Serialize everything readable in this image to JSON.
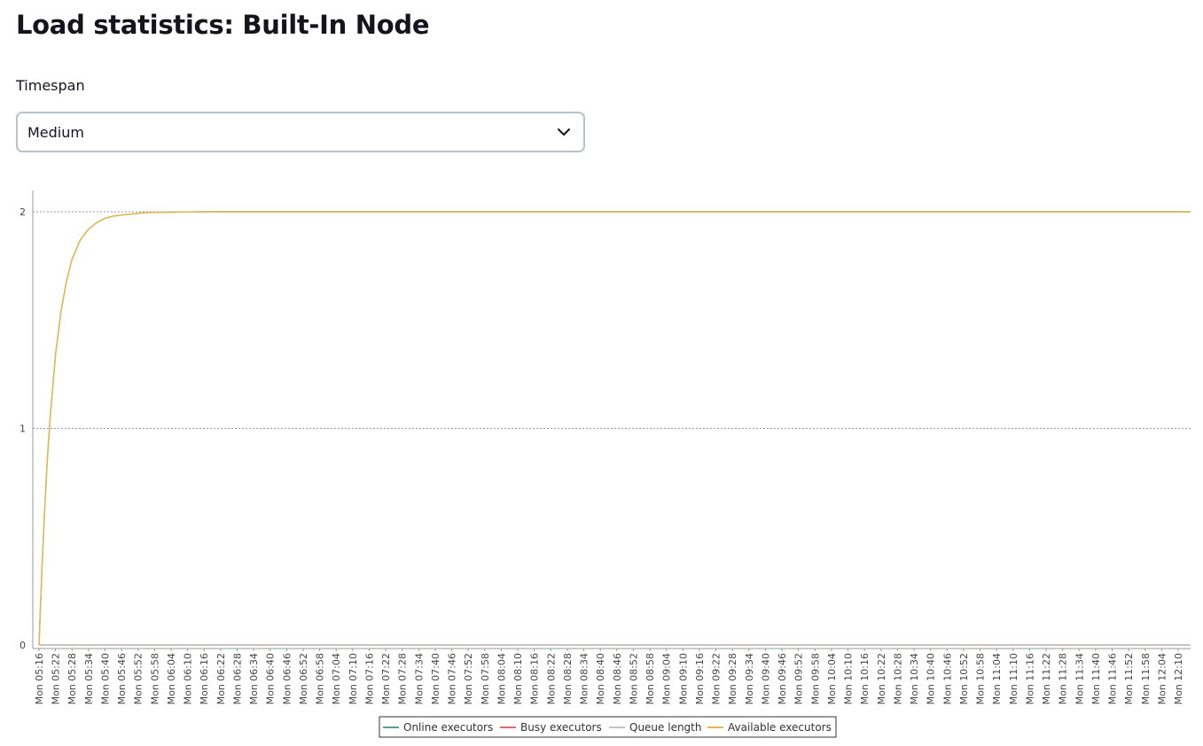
{
  "page": {
    "title": "Load statistics: Built-In Node"
  },
  "timespan": {
    "label": "Timespan",
    "selected": "Medium"
  },
  "icons": {
    "dropdown": "chevron-down-icon"
  },
  "chart_data": {
    "type": "line",
    "grid": true,
    "legend_position": "bottom-center",
    "ylim": [
      0,
      2
    ],
    "y_ticks": [
      "0",
      "1",
      "2"
    ],
    "x_tick_labels": [
      "Mon 05:16",
      "Mon 05:22",
      "Mon 05:28",
      "Mon 05:34",
      "Mon 05:40",
      "Mon 05:46",
      "Mon 05:52",
      "Mon 05:58",
      "Mon 06:04",
      "Mon 06:10",
      "Mon 06:16",
      "Mon 06:22",
      "Mon 06:28",
      "Mon 06:34",
      "Mon 06:40",
      "Mon 06:46",
      "Mon 06:52",
      "Mon 06:58",
      "Mon 07:04",
      "Mon 07:10",
      "Mon 07:16",
      "Mon 07:22",
      "Mon 07:28",
      "Mon 07:34",
      "Mon 07:40",
      "Mon 07:46",
      "Mon 07:52",
      "Mon 07:58",
      "Mon 08:04",
      "Mon 08:10",
      "Mon 08:16",
      "Mon 08:22",
      "Mon 08:28",
      "Mon 08:34",
      "Mon 08:40",
      "Mon 08:46",
      "Mon 08:52",
      "Mon 08:58",
      "Mon 09:04",
      "Mon 09:10",
      "Mon 09:16",
      "Mon 09:22",
      "Mon 09:28",
      "Mon 09:34",
      "Mon 09:40",
      "Mon 09:46",
      "Mon 09:52",
      "Mon 09:58",
      "Mon 10:04",
      "Mon 10:10",
      "Mon 10:16",
      "Mon 10:22",
      "Mon 10:28",
      "Mon 10:34",
      "Mon 10:40",
      "Mon 10:46",
      "Mon 10:52",
      "Mon 10:58",
      "Mon 11:04",
      "Mon 11:10",
      "Mon 11:16",
      "Mon 11:22",
      "Mon 11:28",
      "Mon 11:34",
      "Mon 11:40",
      "Mon 11:46",
      "Mon 11:52",
      "Mon 11:58",
      "Mon 12:04",
      "Mon 12:10"
    ],
    "x": [
      "Mon 05:16",
      "Mon 05:17",
      "Mon 05:18",
      "Mon 05:19",
      "Mon 05:20",
      "Mon 05:22",
      "Mon 05:24",
      "Mon 05:26",
      "Mon 05:28",
      "Mon 05:31",
      "Mon 05:34",
      "Mon 05:37",
      "Mon 05:40",
      "Mon 05:43",
      "Mon 05:46",
      "Mon 05:50",
      "Mon 05:54",
      "Mon 05:58",
      "Mon 06:04",
      "Mon 06:10",
      "Mon 06:16",
      "Mon 06:22",
      "Mon 06:34",
      "Mon 06:46",
      "Mon 07:04",
      "Mon 07:34",
      "Mon 08:04",
      "Mon 08:34",
      "Mon 09:04",
      "Mon 09:34",
      "Mon 10:04",
      "Mon 10:34",
      "Mon 11:04",
      "Mon 11:34",
      "Mon 12:04",
      "Mon 12:16"
    ],
    "series": [
      {
        "name": "Online executors",
        "color": "#5b9e8e",
        "values": [
          0,
          0.33,
          0.61,
          0.85,
          1.04,
          1.34,
          1.54,
          1.68,
          1.78,
          1.87,
          1.92,
          1.95,
          1.97,
          1.98,
          1.985,
          1.99,
          1.995,
          1.997,
          1.998,
          1.999,
          2,
          2,
          2,
          2,
          2,
          2,
          2,
          2,
          2,
          2,
          2,
          2,
          2,
          2,
          2,
          2
        ]
      },
      {
        "name": "Busy executors",
        "color": "#e06c6c",
        "values": [
          0,
          0,
          0,
          0,
          0,
          0,
          0,
          0,
          0,
          0,
          0,
          0,
          0,
          0,
          0,
          0,
          0,
          0,
          0,
          0,
          0,
          0,
          0,
          0,
          0,
          0,
          0,
          0,
          0,
          0,
          0,
          0,
          0,
          0,
          0,
          0
        ]
      },
      {
        "name": "Queue length",
        "color": "#c4c4c4",
        "values": [
          0,
          0,
          0,
          0,
          0,
          0,
          0,
          0,
          0,
          0,
          0,
          0,
          0,
          0,
          0,
          0,
          0,
          0,
          0,
          0,
          0,
          0,
          0,
          0,
          0,
          0,
          0,
          0,
          0,
          0,
          0,
          0,
          0,
          0,
          0,
          0
        ]
      },
      {
        "name": "Available executors",
        "color": "#e8b84a",
        "values": [
          0,
          0.33,
          0.61,
          0.85,
          1.04,
          1.34,
          1.54,
          1.68,
          1.78,
          1.87,
          1.92,
          1.95,
          1.97,
          1.98,
          1.985,
          1.99,
          1.995,
          1.997,
          1.998,
          1.999,
          2,
          2,
          2,
          2,
          2,
          2,
          2,
          2,
          2,
          2,
          2,
          2,
          2,
          2,
          2,
          2
        ]
      }
    ]
  }
}
